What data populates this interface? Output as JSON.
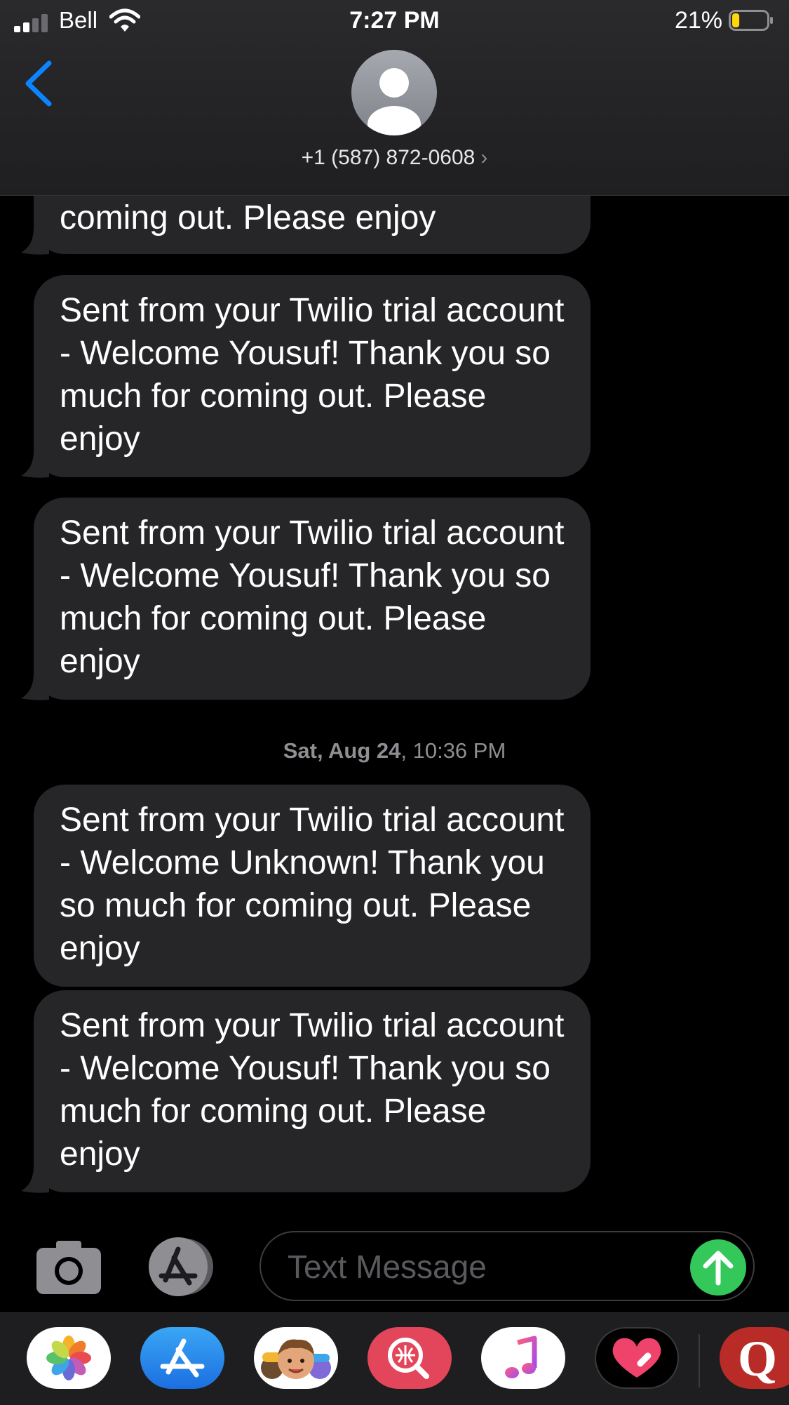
{
  "status_bar": {
    "carrier": "Bell",
    "time": "7:27 PM",
    "battery_percent": "21%",
    "battery_level": 0.21,
    "signal_bars_active": 2,
    "signal_bars_total": 4
  },
  "header": {
    "contact_number": "+1 (587) 872-0608",
    "contact_chevron": "›",
    "back_icon": "chevron-left-icon",
    "avatar_icon": "person-silhouette-icon"
  },
  "messages": [
    {
      "text": "coming out. Please enjoy",
      "direction": "incoming",
      "partial": true
    },
    {
      "text": "Sent from your Twilio trial account - Welcome Yousuf! Thank you so much for coming out. Please enjoy",
      "direction": "incoming"
    },
    {
      "text": "Sent from your Twilio trial account - Welcome Yousuf! Thank you so much for coming out. Please enjoy",
      "direction": "incoming"
    },
    {
      "text": "Sent from your Twilio trial account - Welcome Unknown! Thank you so much for coming out. Please enjoy",
      "direction": "incoming"
    },
    {
      "text": "Sent from your Twilio trial account - Welcome Yousuf! Thank you so much for coming out. Please enjoy",
      "direction": "incoming"
    }
  ],
  "timestamp": {
    "day": "Sat, Aug 24",
    "time": ", 10:36 PM"
  },
  "input_bar": {
    "placeholder": "Text Message",
    "value": "",
    "camera_icon": "camera-icon",
    "apps_icon": "app-store-icon",
    "send_icon": "arrow-up-icon"
  },
  "app_drawer": [
    {
      "name": "photos-app-icon"
    },
    {
      "name": "app-store-app-icon"
    },
    {
      "name": "memoji-app-icon"
    },
    {
      "name": "image-search-app-icon"
    },
    {
      "name": "music-app-icon"
    },
    {
      "name": "heart-app-icon"
    },
    {
      "name": "q-app-icon",
      "letter": "Q"
    }
  ],
  "colors": {
    "accent_blue": "#0a84ff",
    "bubble_bg": "#262628",
    "send_green": "#34c759",
    "battery_yellow": "#ffd60a"
  }
}
